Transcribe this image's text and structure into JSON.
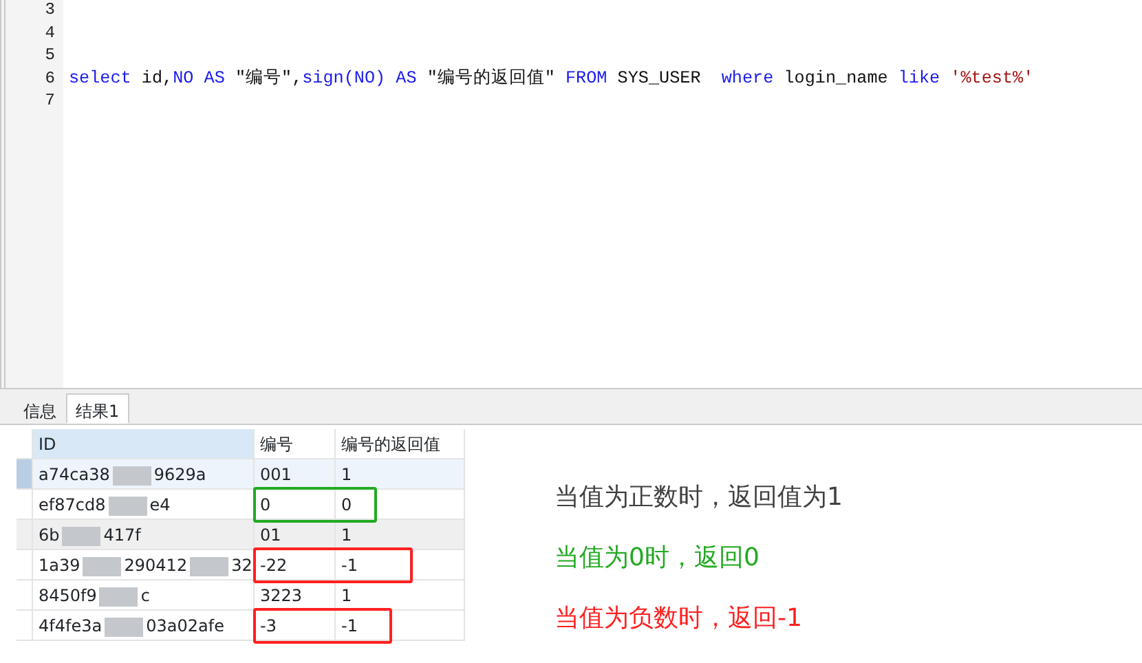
{
  "editor": {
    "lines": [
      {
        "number": "3"
      },
      {
        "number": "4"
      },
      {
        "number": "5"
      },
      {
        "number": "6",
        "tokens": [
          {
            "kind": "keyword",
            "text": "select"
          },
          {
            "kind": "plain",
            "text": " id,"
          },
          {
            "kind": "keyword",
            "text": "NO AS"
          },
          {
            "kind": "plain",
            "text": " \"编号\","
          },
          {
            "kind": "keyword",
            "text": "sign(NO) AS"
          },
          {
            "kind": "plain",
            "text": " \"编号的返回值\" "
          },
          {
            "kind": "keyword",
            "text": "FROM"
          },
          {
            "kind": "plain",
            "text": " SYS_USER  "
          },
          {
            "kind": "keyword",
            "text": "where"
          },
          {
            "kind": "plain",
            "text": " login_name "
          },
          {
            "kind": "keyword",
            "text": "like"
          },
          {
            "kind": "string",
            "text": " '%test%'"
          }
        ]
      },
      {
        "number": "7"
      }
    ]
  },
  "tabs": [
    {
      "label": "信息",
      "selected": false
    },
    {
      "label": "结果1",
      "selected": true
    }
  ],
  "grid": {
    "columns": [
      "ID",
      "编号",
      "编号的返回值"
    ],
    "rows": [
      {
        "id_parts": [
          "a74ca38",
          "9629a"
        ],
        "no": "001",
        "sign": "1",
        "selected": true
      },
      {
        "id_parts": [
          "ef87cd8",
          "e4"
        ],
        "no": "0",
        "sign": "0",
        "selected": false,
        "color": "#22aa22"
      },
      {
        "id_parts": [
          "6b",
          "417f"
        ],
        "no": "01",
        "sign": "1",
        "selected": false
      },
      {
        "id_parts": [
          "1a39",
          "290412",
          "32"
        ],
        "no": "-22",
        "sign": "-1",
        "selected": false,
        "color": "#ff2020"
      },
      {
        "id_parts": [
          "8450f9",
          "c"
        ],
        "no": "3223",
        "sign": "1",
        "selected": false
      },
      {
        "id_parts": [
          "4f4fe3a",
          "03a02afe"
        ],
        "no": "-3",
        "sign": "-1",
        "selected": false,
        "color": "#ff2020"
      }
    ]
  },
  "notes": [
    {
      "text": "当值为正数时，返回值为1",
      "color": "#404040"
    },
    {
      "text": "当值为0时，返回0",
      "color": "#22aa22"
    },
    {
      "text": "当值为负数时，返回-1",
      "color": "#ff2020"
    }
  ]
}
